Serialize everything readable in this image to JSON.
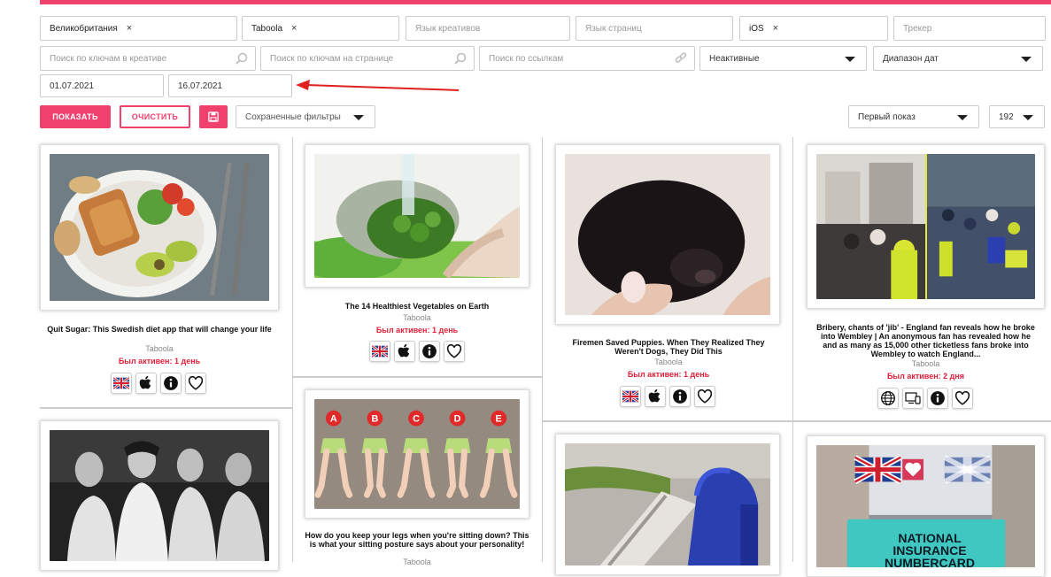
{
  "filters": {
    "country_tag": "Великобритания",
    "network_tag": "Taboola",
    "creative_lang_placeholder": "Язык креативов",
    "page_lang_placeholder": "Язык страниц",
    "os_tag": "iOS",
    "tracker_placeholder": "Трекер",
    "creative_keywords_placeholder": "Поиск по ключам в креативе",
    "page_keywords_placeholder": "Поиск по ключам на странице",
    "links_placeholder": "Поиск по ссылкам",
    "status_value": "Неактивные",
    "date_range_value": "Диапазон дат",
    "date_from": "01.07.2021",
    "date_to": "16.07.2021",
    "remove_symbol": "×"
  },
  "actions": {
    "show_label": "ПОКАЗАТЬ",
    "clear_label": "ОЧИСТИТЬ",
    "saved_filters_label": "Сохраненные фильтры",
    "sort_value": "Первый показ",
    "per_page_value": "192"
  },
  "cards": [
    {
      "title": "Quit Sugar: This Swedish diet app that will change your life",
      "source": "Taboola",
      "active": "Был активен: 1 день",
      "icons": [
        "uk-flag-icon",
        "apple-icon",
        "info-icon",
        "heart-icon"
      ]
    },
    {
      "title": "The 14 Healthiest Vegetables on Earth",
      "source": "Taboola",
      "active": "Был активен: 1 день",
      "icons": [
        "uk-flag-icon",
        "apple-icon",
        "info-icon",
        "heart-icon"
      ]
    },
    {
      "title": "Firemen Saved Puppies. When They Realized They Weren't Dogs, They Did This",
      "source": "Taboola",
      "active": "Был активен: 1 день",
      "icons": [
        "uk-flag-icon",
        "apple-icon",
        "info-icon",
        "heart-icon"
      ]
    },
    {
      "title": "Bribery, chants of 'jib' - England fan reveals how he broke into Wembley | An anonymous fan has revealed how he and as many as 15,000 other ticketless fans broke into Wembley to watch England...",
      "source": "Taboola",
      "active": "Был активен: 2 дня",
      "icons": [
        "globe-icon",
        "devices-icon",
        "info-icon",
        "heart-icon"
      ]
    },
    {
      "title": "How do you keep your legs when you're sitting down? This is what your sitting posture says about your personality!",
      "source": "Taboola"
    },
    {
      "overlay_text": [
        "NATIONAL",
        "INSURANCE",
        "NUMBERCARD"
      ]
    },
    {
      "poses": [
        "A",
        "B",
        "C",
        "D",
        "E"
      ]
    }
  ],
  "colors": {
    "accent": "#f0416e",
    "active_text": "#e0203a"
  }
}
